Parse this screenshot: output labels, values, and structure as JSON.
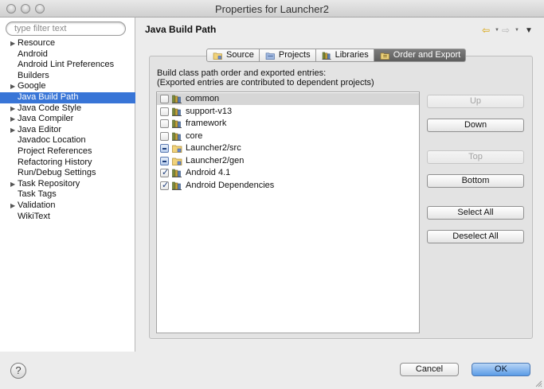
{
  "window": {
    "title": "Properties for Launcher2"
  },
  "search": {
    "placeholder": "type filter text"
  },
  "tree": [
    {
      "label": "Resource",
      "expandable": true,
      "selected": false
    },
    {
      "label": "Android",
      "expandable": false,
      "selected": false
    },
    {
      "label": "Android Lint Preferences",
      "expandable": false,
      "selected": false
    },
    {
      "label": "Builders",
      "expandable": false,
      "selected": false
    },
    {
      "label": "Google",
      "expandable": true,
      "selected": false
    },
    {
      "label": "Java Build Path",
      "expandable": false,
      "selected": true
    },
    {
      "label": "Java Code Style",
      "expandable": true,
      "selected": false
    },
    {
      "label": "Java Compiler",
      "expandable": true,
      "selected": false
    },
    {
      "label": "Java Editor",
      "expandable": true,
      "selected": false
    },
    {
      "label": "Javadoc Location",
      "expandable": false,
      "selected": false
    },
    {
      "label": "Project References",
      "expandable": false,
      "selected": false
    },
    {
      "label": "Refactoring History",
      "expandable": false,
      "selected": false
    },
    {
      "label": "Run/Debug Settings",
      "expandable": false,
      "selected": false
    },
    {
      "label": "Task Repository",
      "expandable": true,
      "selected": false
    },
    {
      "label": "Task Tags",
      "expandable": false,
      "selected": false
    },
    {
      "label": "Validation",
      "expandable": true,
      "selected": false
    },
    {
      "label": "WikiText",
      "expandable": false,
      "selected": false
    }
  ],
  "page": {
    "title": "Java Build Path"
  },
  "tabs": [
    {
      "label": "Source",
      "icon": "source-folder-icon",
      "active": false
    },
    {
      "label": "Projects",
      "icon": "project-folder-icon",
      "active": false
    },
    {
      "label": "Libraries",
      "icon": "library-icon",
      "active": false
    },
    {
      "label": "Order and Export",
      "icon": "order-export-icon",
      "active": true
    }
  ],
  "description": {
    "line1": "Build class path order and exported entries:",
    "line2": "(Exported entries are contributed to dependent projects)"
  },
  "entries": [
    {
      "label": "common",
      "state": "unchecked",
      "icon": "library-icon",
      "highlighted": true
    },
    {
      "label": "support-v13",
      "state": "unchecked",
      "icon": "library-icon",
      "highlighted": false
    },
    {
      "label": "framework",
      "state": "unchecked",
      "icon": "library-icon",
      "highlighted": false
    },
    {
      "label": "core",
      "state": "unchecked",
      "icon": "library-icon",
      "highlighted": false
    },
    {
      "label": "Launcher2/src",
      "state": "partial",
      "icon": "source-folder-icon",
      "highlighted": false
    },
    {
      "label": "Launcher2/gen",
      "state": "partial",
      "icon": "source-folder-icon",
      "highlighted": false
    },
    {
      "label": "Android 4.1",
      "state": "checked",
      "icon": "library-icon",
      "highlighted": false
    },
    {
      "label": "Android Dependencies",
      "state": "checked",
      "icon": "library-icon",
      "highlighted": false
    }
  ],
  "side_buttons": [
    {
      "label": "Up",
      "enabled": false
    },
    {
      "label": "Down",
      "enabled": true
    },
    {
      "label": "Top",
      "enabled": false
    },
    {
      "label": "Bottom",
      "enabled": true
    },
    {
      "label": "Select All",
      "enabled": true
    },
    {
      "label": "Deselect All",
      "enabled": true
    }
  ],
  "footer": {
    "help_label": "?",
    "cancel_label": "Cancel",
    "ok_label": "OK"
  },
  "colors": {
    "selection": "#3875d7",
    "primary_button": "#5a9be6",
    "back_arrow": "#d8a000"
  }
}
